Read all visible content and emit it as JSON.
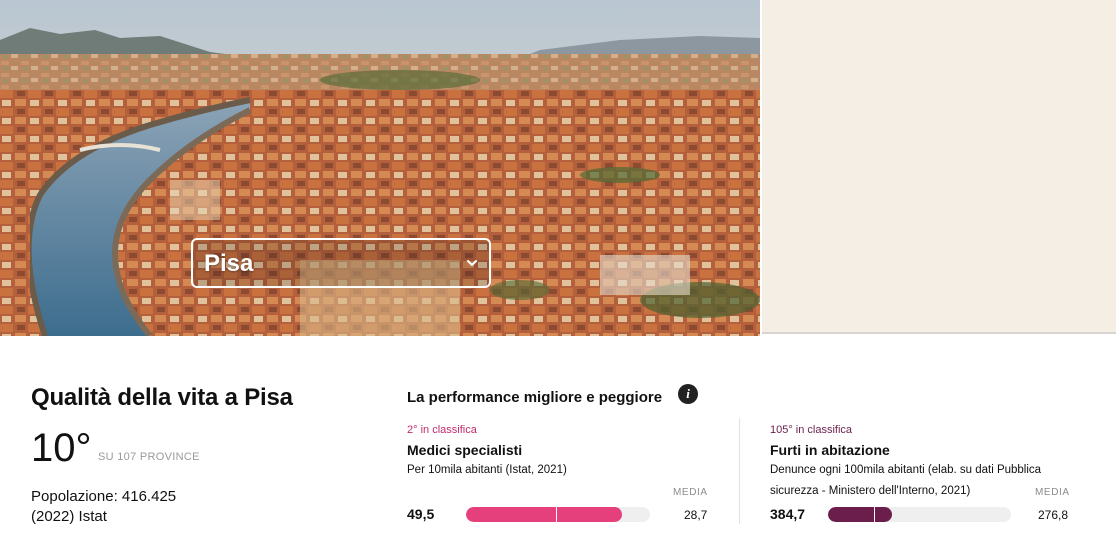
{
  "city_select": {
    "value": "Pisa"
  },
  "header": {
    "title": "Qualità della vita a Pisa",
    "rank": "10°",
    "rank_note": "SU 107 PROVINCE",
    "population": "Popolazione: 416.425 (2022) Istat"
  },
  "performance": {
    "title": "La performance migliore e peggiore",
    "best": {
      "rank": "2° in classifica",
      "name": "Medici specialisti",
      "description": "Per 10mila abitanti (Istat, 2021)",
      "media_label": "MEDIA",
      "value": "49,5",
      "average": "28,7",
      "fill_fraction": 0.85,
      "avg_fraction": 0.49,
      "color": "#e5407b"
    },
    "worst": {
      "rank": "105° in classifica",
      "name": "Furti in abitazione",
      "description": "Denunce ogni 100mila abitanti (elab. su dati Pubblica sicurezza - Ministero dell'Interno, 2021)",
      "media_label": "MEDIA",
      "value": "384,7",
      "average": "276,8",
      "fill_fraction": 0.35,
      "avg_fraction": 0.25,
      "color": "#6b1e4c"
    }
  },
  "icons": {
    "select": "chevron-down-icon",
    "info": "info-icon"
  }
}
